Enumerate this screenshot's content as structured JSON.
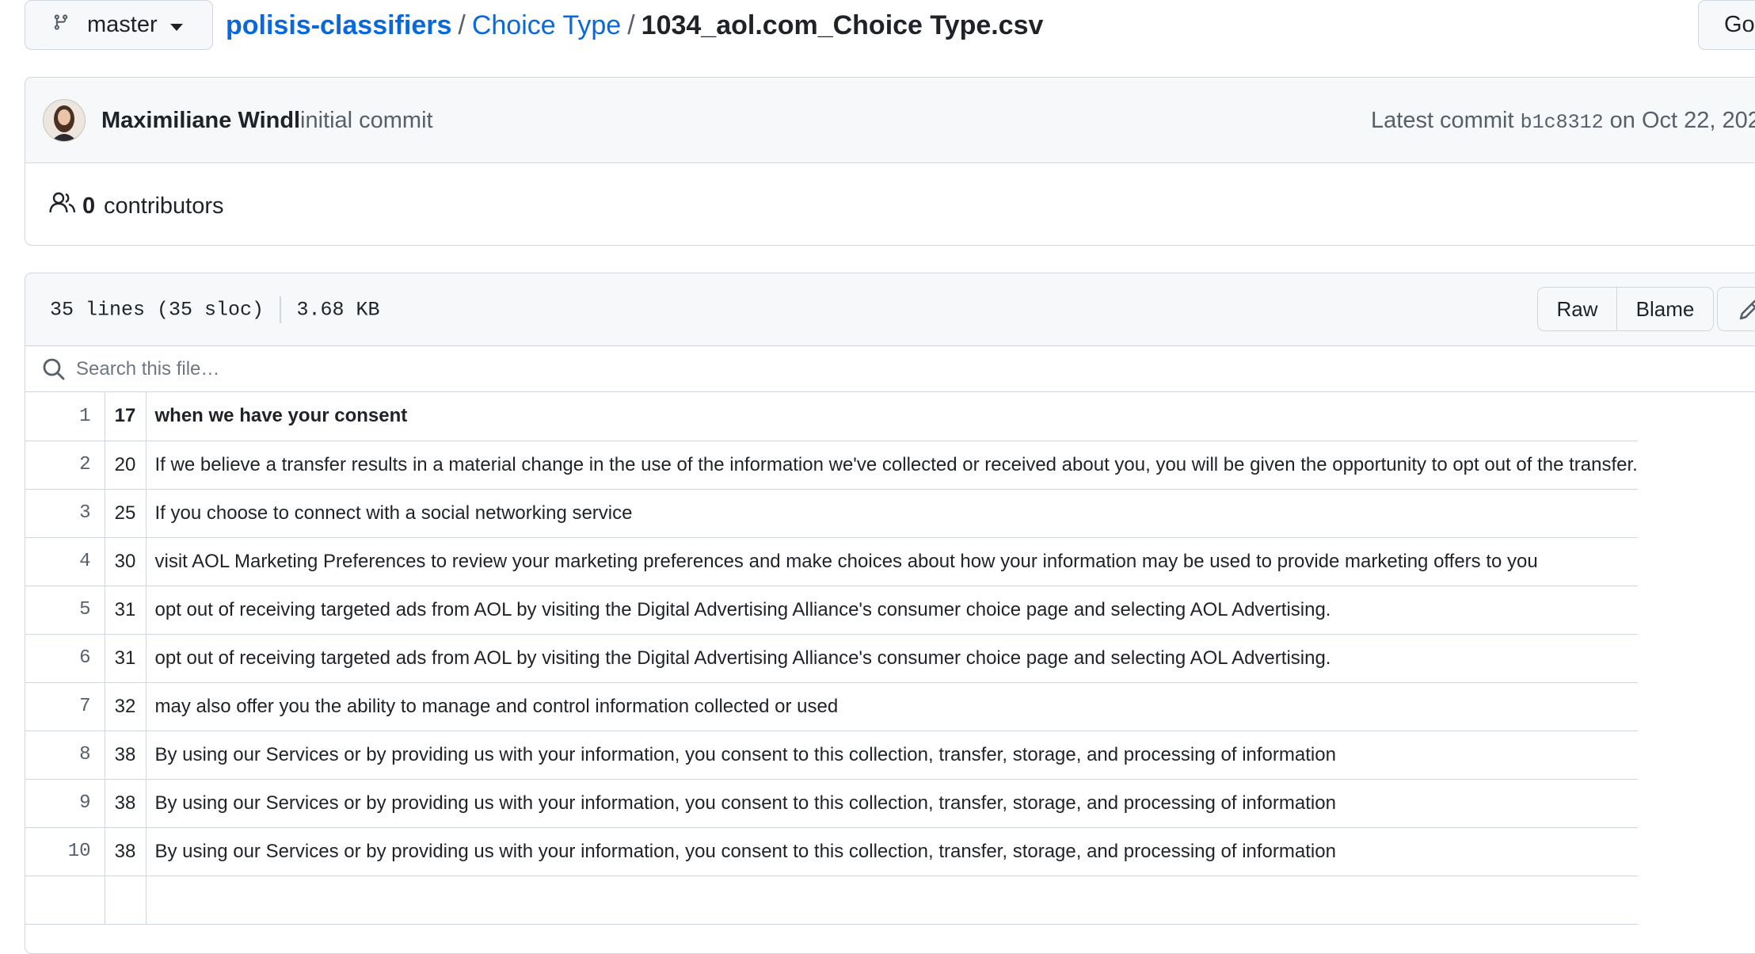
{
  "branch": {
    "name": "master",
    "icon": "git-branch-icon",
    "caret": "triangle-down-icon"
  },
  "breadcrumb": {
    "repo": "polisis-classifiers",
    "separator": "/",
    "folder": "Choice Type",
    "file": "1034_aol.com_Choice Type.csv"
  },
  "goto_button": {
    "label": "Go"
  },
  "commit": {
    "author": "Maximiliane Windl",
    "message": "initial commit",
    "latest_prefix": "Latest commit",
    "sha": "b1c8312",
    "date": "on Oct 22, 202"
  },
  "contributors": {
    "count": "0",
    "label": "contributors"
  },
  "file_info": {
    "lines": "35 lines (35 sloc)",
    "size": "3.68 KB"
  },
  "actions": {
    "raw": "Raw",
    "blame": "Blame",
    "edit_icon": "pencil-icon"
  },
  "search": {
    "placeholder": "Search this file…",
    "icon": "search-icon"
  },
  "table": {
    "rows": [
      {
        "line": "1",
        "col1": "17",
        "col2": "when we have your consent"
      },
      {
        "line": "2",
        "col1": "20",
        "col2": "If we believe a transfer results in a material change in the use of the information we've collected or received about you, you will be given the opportunity to opt out of the transfer."
      },
      {
        "line": "3",
        "col1": "25",
        "col2": "If you choose to connect with a social networking service"
      },
      {
        "line": "4",
        "col1": "30",
        "col2": "visit AOL Marketing Preferences to review your marketing preferences and make choices about how your information may be used to provide marketing offers to you"
      },
      {
        "line": "5",
        "col1": "31",
        "col2": "opt out of receiving targeted ads from AOL by visiting the Digital Advertising Alliance's consumer choice page and selecting AOL Advertising."
      },
      {
        "line": "6",
        "col1": "31",
        "col2": "opt out of receiving targeted ads from AOL by visiting the Digital Advertising Alliance's consumer choice page and selecting AOL Advertising."
      },
      {
        "line": "7",
        "col1": "32",
        "col2": "may also offer you the ability to manage and control information collected or used"
      },
      {
        "line": "8",
        "col1": "38",
        "col2": "By using our Services or by providing us with your information, you consent to this collection, transfer, storage, and processing of information"
      },
      {
        "line": "9",
        "col1": "38",
        "col2": "By using our Services or by providing us with your information, you consent to this collection, transfer, storage, and processing of information"
      },
      {
        "line": "10",
        "col1": "38",
        "col2": "By using our Services or by providing us with your information, you consent to this collection, transfer, storage, and processing of information"
      },
      {
        "line": "",
        "col1": "",
        "col2": ""
      }
    ]
  }
}
